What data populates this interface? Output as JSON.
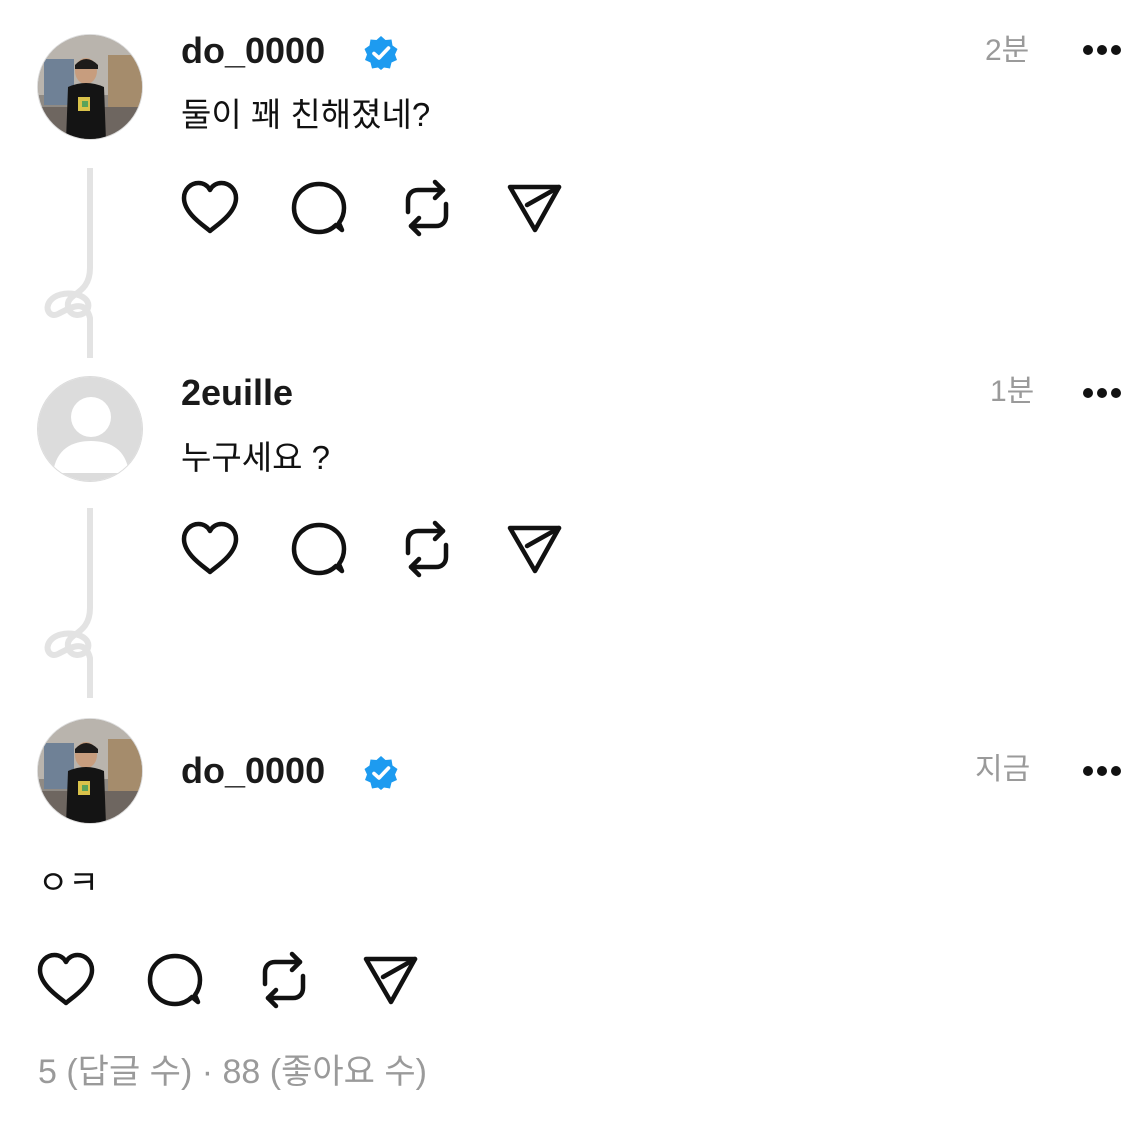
{
  "thread": {
    "posts": [
      {
        "username": "do_0000",
        "verified": true,
        "timestamp": "2분",
        "text": "둘이 꽤 친해졌네?",
        "avatar": "profile-photo"
      },
      {
        "username": "2euille",
        "verified": false,
        "timestamp": "1분",
        "text": "누구세요 ?",
        "avatar": "default-avatar"
      },
      {
        "username": "do_0000",
        "verified": true,
        "timestamp": "지금",
        "text": "ㅇㅋ",
        "avatar": "profile-photo"
      }
    ],
    "stats": "5 (답글 수) · 88 (좋아요 수)"
  },
  "icons": {
    "like": "heart-icon",
    "reply": "comment-icon",
    "repost": "repost-icon",
    "share": "send-icon",
    "more": "more-icon",
    "verified": "verified-badge-icon"
  },
  "colors": {
    "verified_blue": "#1d9bf0",
    "muted_text": "#9a9a9a",
    "thread_line": "#e3e3e3"
  }
}
